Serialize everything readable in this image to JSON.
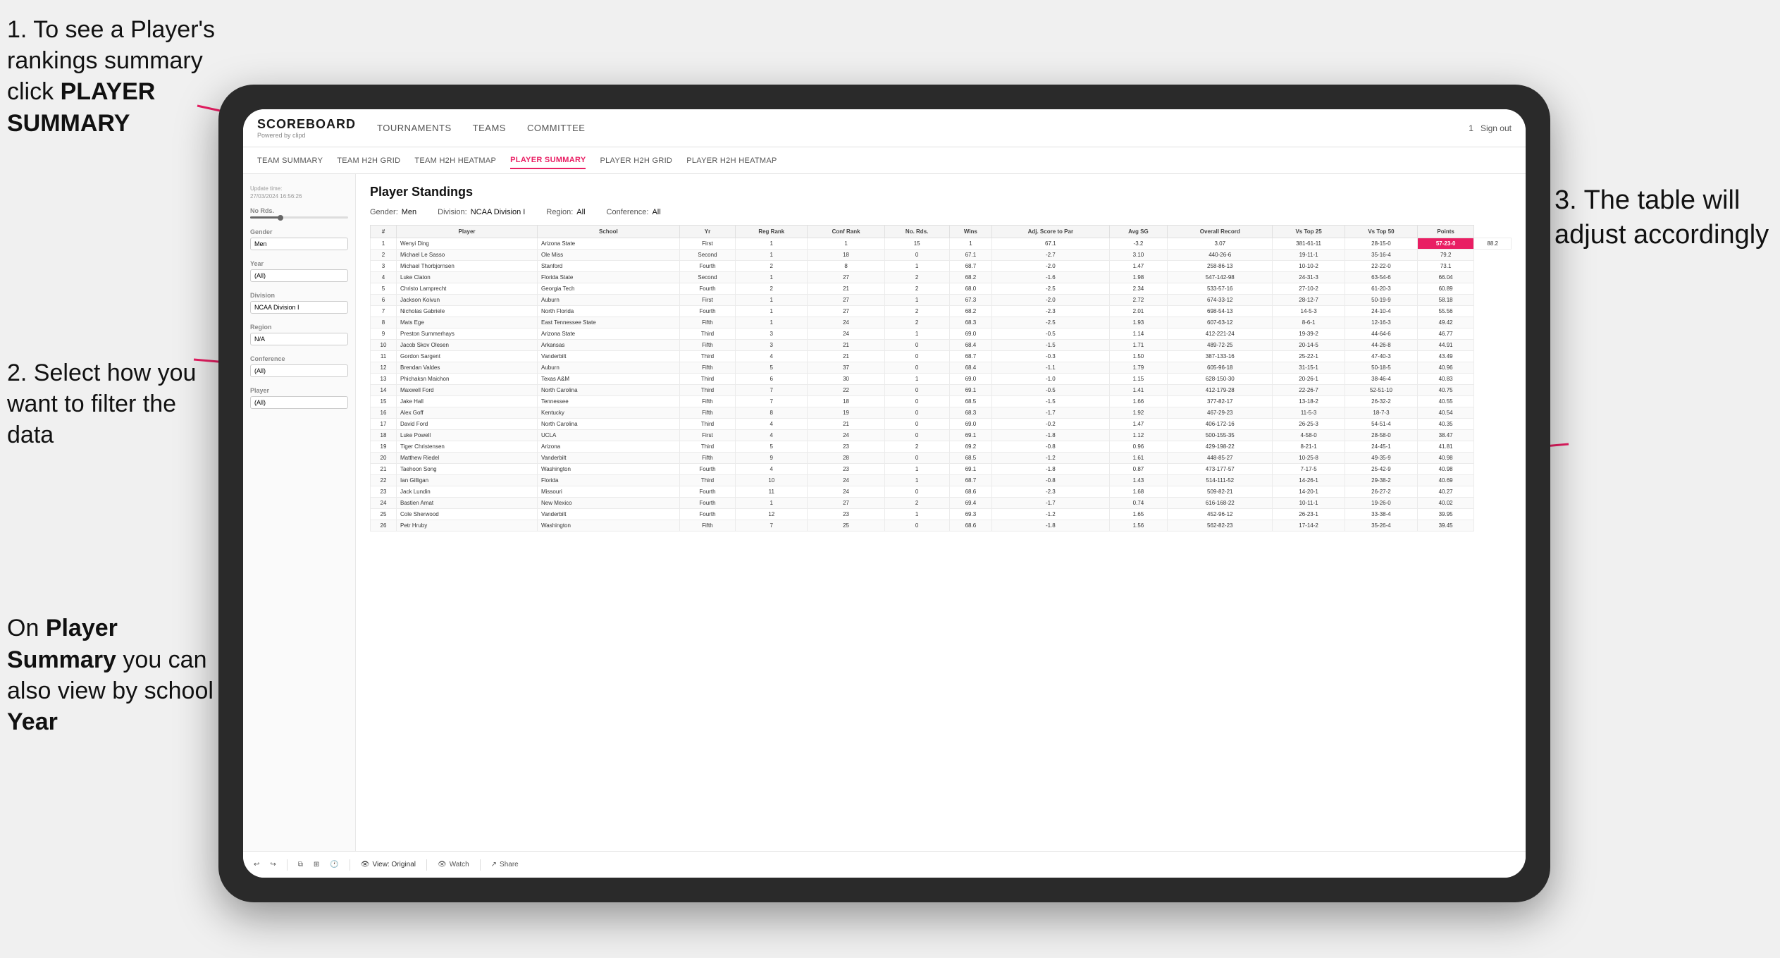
{
  "instructions": {
    "step1": "1. To see a Player's rankings summary click ",
    "step1_bold": "PLAYER SUMMARY",
    "step2": "2. Select how you want to filter the data",
    "note_prefix": "On ",
    "note_bold1": "Player Summary",
    "note_mid": " you can also view by school ",
    "note_bold2": "Year",
    "step3": "3. The table will adjust accordingly"
  },
  "header": {
    "logo": "SCOREBOARD",
    "logo_sub": "Powered by clipd",
    "nav_items": [
      "TOURNAMENTS",
      "TEAMS",
      "COMMITTEE"
    ],
    "header_right": "Sign out"
  },
  "sub_nav": {
    "items": [
      "TEAM SUMMARY",
      "TEAM H2H GRID",
      "TEAM H2H HEATMAP",
      "PLAYER SUMMARY",
      "PLAYER H2H GRID",
      "PLAYER H2H HEATMAP"
    ],
    "active": "PLAYER SUMMARY"
  },
  "sidebar": {
    "update_label": "Update time:",
    "update_time": "27/03/2024 16:56:26",
    "no_rds_label": "No Rds.",
    "gender_label": "Gender",
    "gender_value": "Men",
    "year_label": "Year",
    "year_value": "(All)",
    "division_label": "Division",
    "division_value": "NCAA Division I",
    "region_label": "Region",
    "region_value": "N/A",
    "conference_label": "Conference",
    "conference_value": "(All)",
    "player_label": "Player",
    "player_value": "(All)"
  },
  "content": {
    "title": "Player Standings",
    "filters": {
      "gender_label": "Gender:",
      "gender_value": "Men",
      "division_label": "Division:",
      "division_value": "NCAA Division I",
      "region_label": "Region:",
      "region_value": "All",
      "conference_label": "Conference:",
      "conference_value": "All"
    },
    "table_headers": [
      "#",
      "Player",
      "School",
      "Yr",
      "Reg Rank",
      "Conf Rank",
      "No. Rds.",
      "Wins",
      "Adj. Score to Par",
      "Avg SG",
      "Overall Record",
      "Vs Top 25",
      "Vs Top 50",
      "Points"
    ],
    "rows": [
      [
        "1",
        "Wenyi Ding",
        "Arizona State",
        "First",
        "1",
        "1",
        "15",
        "1",
        "67.1",
        "-3.2",
        "3.07",
        "381-61-11",
        "28-15-0",
        "57-23-0",
        "88.2"
      ],
      [
        "2",
        "Michael Le Sasso",
        "Ole Miss",
        "Second",
        "1",
        "18",
        "0",
        "67.1",
        "-2.7",
        "3.10",
        "440-26-6",
        "19-11-1",
        "35-16-4",
        "79.2"
      ],
      [
        "3",
        "Michael Thorbjornsen",
        "Stanford",
        "Fourth",
        "2",
        "8",
        "1",
        "68.7",
        "-2.0",
        "1.47",
        "258-86-13",
        "10-10-2",
        "22-22-0",
        "73.1"
      ],
      [
        "4",
        "Luke Claton",
        "Florida State",
        "Second",
        "1",
        "27",
        "2",
        "68.2",
        "-1.6",
        "1.98",
        "547-142-98",
        "24-31-3",
        "63-54-6",
        "66.04"
      ],
      [
        "5",
        "Christo Lamprecht",
        "Georgia Tech",
        "Fourth",
        "2",
        "21",
        "2",
        "68.0",
        "-2.5",
        "2.34",
        "533-57-16",
        "27-10-2",
        "61-20-3",
        "60.89"
      ],
      [
        "6",
        "Jackson Koivun",
        "Auburn",
        "First",
        "1",
        "27",
        "1",
        "67.3",
        "-2.0",
        "2.72",
        "674-33-12",
        "28-12-7",
        "50-19-9",
        "58.18"
      ],
      [
        "7",
        "Nicholas Gabriele",
        "North Florida",
        "Fourth",
        "1",
        "27",
        "2",
        "68.2",
        "-2.3",
        "2.01",
        "698-54-13",
        "14-5-3",
        "24-10-4",
        "55.56"
      ],
      [
        "8",
        "Mats Ege",
        "East Tennessee State",
        "Fifth",
        "1",
        "24",
        "2",
        "68.3",
        "-2.5",
        "1.93",
        "607-63-12",
        "8-6-1",
        "12-16-3",
        "49.42"
      ],
      [
        "9",
        "Preston Summerhays",
        "Arizona State",
        "Third",
        "3",
        "24",
        "1",
        "69.0",
        "-0.5",
        "1.14",
        "412-221-24",
        "19-39-2",
        "44-64-6",
        "46.77"
      ],
      [
        "10",
        "Jacob Skov Olesen",
        "Arkansas",
        "Fifth",
        "3",
        "21",
        "0",
        "68.4",
        "-1.5",
        "1.71",
        "489-72-25",
        "20-14-5",
        "44-26-8",
        "44.91"
      ],
      [
        "11",
        "Gordon Sargent",
        "Vanderbilt",
        "Third",
        "4",
        "21",
        "0",
        "68.7",
        "-0.3",
        "1.50",
        "387-133-16",
        "25-22-1",
        "47-40-3",
        "43.49"
      ],
      [
        "12",
        "Brendan Valdes",
        "Auburn",
        "Fifth",
        "5",
        "37",
        "0",
        "68.4",
        "-1.1",
        "1.79",
        "605-96-18",
        "31-15-1",
        "50-18-5",
        "40.96"
      ],
      [
        "13",
        "Phichaksn Maichon",
        "Texas A&M",
        "Third",
        "6",
        "30",
        "1",
        "69.0",
        "-1.0",
        "1.15",
        "628-150-30",
        "20-26-1",
        "38-46-4",
        "40.83"
      ],
      [
        "14",
        "Maxwell Ford",
        "North Carolina",
        "Third",
        "7",
        "22",
        "0",
        "69.1",
        "-0.5",
        "1.41",
        "412-179-28",
        "22-26-7",
        "52-51-10",
        "40.75"
      ],
      [
        "15",
        "Jake Hall",
        "Tennessee",
        "Fifth",
        "7",
        "18",
        "0",
        "68.5",
        "-1.5",
        "1.66",
        "377-82-17",
        "13-18-2",
        "26-32-2",
        "40.55"
      ],
      [
        "16",
        "Alex Goff",
        "Kentucky",
        "Fifth",
        "8",
        "19",
        "0",
        "68.3",
        "-1.7",
        "1.92",
        "467-29-23",
        "11-5-3",
        "18-7-3",
        "40.54"
      ],
      [
        "17",
        "David Ford",
        "North Carolina",
        "Third",
        "4",
        "21",
        "0",
        "69.0",
        "-0.2",
        "1.47",
        "406-172-16",
        "26-25-3",
        "54-51-4",
        "40.35"
      ],
      [
        "18",
        "Luke Powell",
        "UCLA",
        "First",
        "4",
        "24",
        "0",
        "69.1",
        "-1.8",
        "1.12",
        "500-155-35",
        "4-58-0",
        "28-58-0",
        "38.47"
      ],
      [
        "19",
        "Tiger Christensen",
        "Arizona",
        "Third",
        "5",
        "23",
        "2",
        "69.2",
        "-0.8",
        "0.96",
        "429-198-22",
        "8-21-1",
        "24-45-1",
        "41.81"
      ],
      [
        "20",
        "Matthew Riedel",
        "Vanderbilt",
        "Fifth",
        "9",
        "28",
        "0",
        "68.5",
        "-1.2",
        "1.61",
        "448-85-27",
        "10-25-8",
        "49-35-9",
        "40.98"
      ],
      [
        "21",
        "Taehoon Song",
        "Washington",
        "Fourth",
        "4",
        "23",
        "1",
        "69.1",
        "-1.8",
        "0.87",
        "473-177-57",
        "7-17-5",
        "25-42-9",
        "40.98"
      ],
      [
        "22",
        "Ian Gilligan",
        "Florida",
        "Third",
        "10",
        "24",
        "1",
        "68.7",
        "-0.8",
        "1.43",
        "514-111-52",
        "14-26-1",
        "29-38-2",
        "40.69"
      ],
      [
        "23",
        "Jack Lundin",
        "Missouri",
        "Fourth",
        "11",
        "24",
        "0",
        "68.6",
        "-2.3",
        "1.68",
        "509-82-21",
        "14-20-1",
        "26-27-2",
        "40.27"
      ],
      [
        "24",
        "Bastien Amat",
        "New Mexico",
        "Fourth",
        "1",
        "27",
        "2",
        "69.4",
        "-1.7",
        "0.74",
        "616-168-22",
        "10-11-1",
        "19-26-0",
        "40.02"
      ],
      [
        "25",
        "Cole Sherwood",
        "Vanderbilt",
        "Fourth",
        "12",
        "23",
        "1",
        "69.3",
        "-1.2",
        "1.65",
        "452-96-12",
        "26-23-1",
        "33-38-4",
        "39.95"
      ],
      [
        "26",
        "Petr Hruby",
        "Washington",
        "Fifth",
        "7",
        "25",
        "0",
        "68.6",
        "-1.8",
        "1.56",
        "562-82-23",
        "17-14-2",
        "35-26-4",
        "39.45"
      ]
    ]
  },
  "toolbar": {
    "undo": "↩",
    "redo": "↪",
    "view_label": "View: Original",
    "watch": "Watch",
    "share": "Share"
  }
}
